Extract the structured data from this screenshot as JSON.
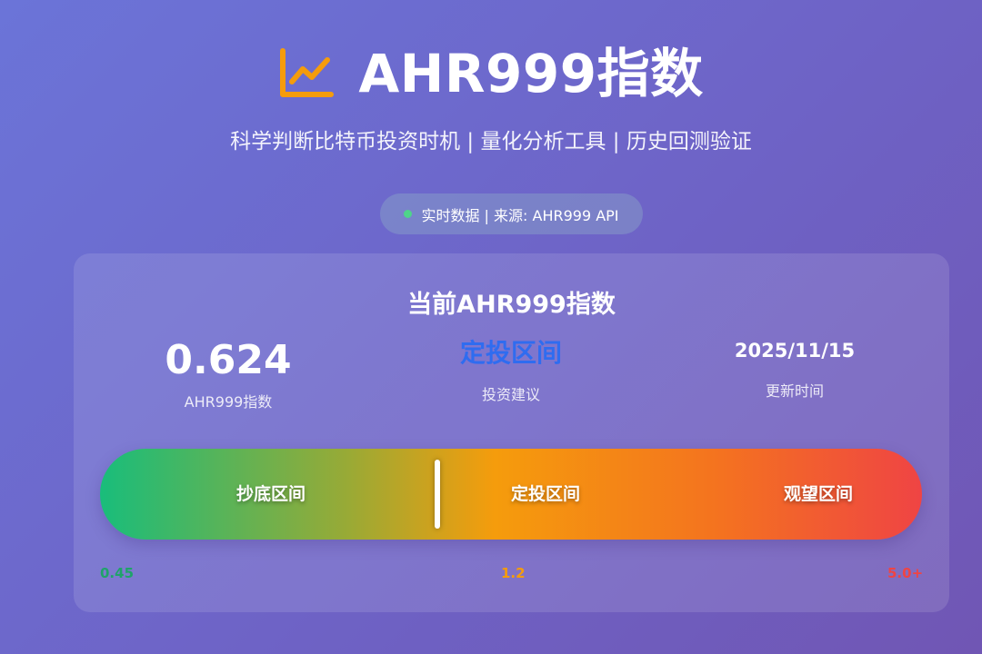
{
  "header": {
    "title": "AHR999指数",
    "subtitle": "科学判断比特币投资时机 | 量化分析工具 | 历史回测验证",
    "logo_icon": "chart-line-icon",
    "logo_color": "#f59c0c"
  },
  "status": {
    "text": "实时数据 | 来源: AHR999 API",
    "dot_color": "#4ed48a"
  },
  "card": {
    "title": "当前AHR999指数",
    "index": {
      "value": "0.624",
      "label": "AHR999指数"
    },
    "advice": {
      "value": "定投区间",
      "label": "投资建议",
      "color": "#2f6cf0"
    },
    "update": {
      "value": "2025/11/15",
      "label": "更新时间"
    }
  },
  "gauge": {
    "zones": [
      "抄底区间",
      "定投区间",
      "观望区间"
    ],
    "scale": {
      "min": "0.45",
      "mid": "1.2",
      "max": "5.0+"
    },
    "current_value": 0.624,
    "marker_fraction": 0.41,
    "colors": {
      "buy": "#19bd7b",
      "dca": "#f59c0c",
      "watch": "#ef4444"
    }
  }
}
